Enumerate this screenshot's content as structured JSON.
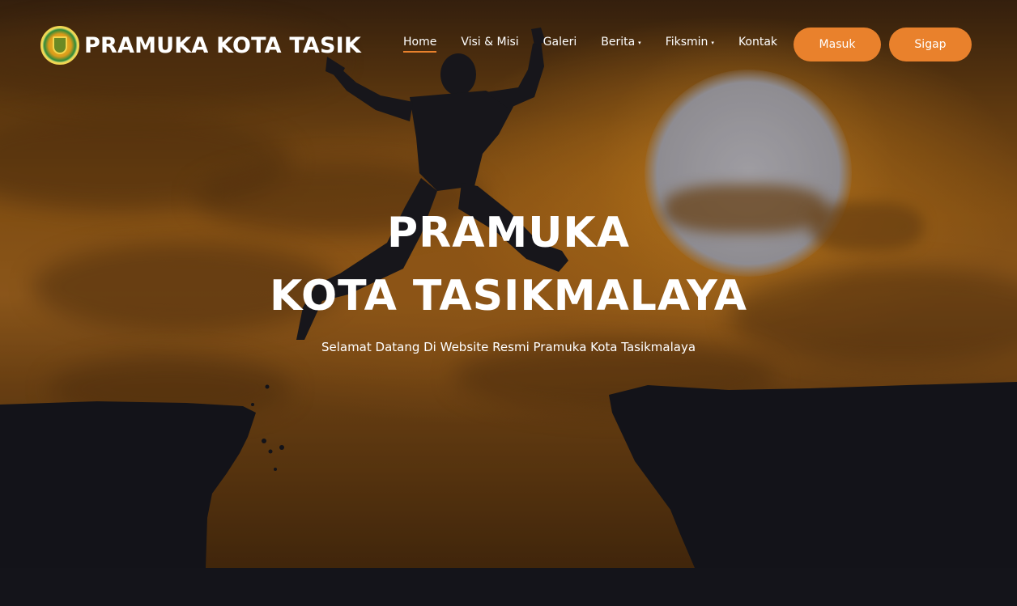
{
  "brand": {
    "name": "PRAMUKA KOTA TASIK"
  },
  "nav": {
    "items": [
      {
        "label": "Home",
        "active": true,
        "dropdown": false
      },
      {
        "label": "Visi & Misi",
        "active": false,
        "dropdown": false
      },
      {
        "label": "Galeri",
        "active": false,
        "dropdown": false
      },
      {
        "label": "Berita",
        "active": false,
        "dropdown": true
      },
      {
        "label": "Fiksmin",
        "active": false,
        "dropdown": true
      },
      {
        "label": "Kontak",
        "active": false,
        "dropdown": false
      }
    ],
    "dropdown_glyph": "▾"
  },
  "buttons": {
    "masuk": "Masuk",
    "sigap": "Sigap"
  },
  "hero": {
    "title_line1": "PRAMUKA",
    "title_line2": "KOTA TASIKMALAYA",
    "subtitle": "Selamat Datang Di Website Resmi Pramuka Kota Tasikmalaya"
  },
  "colors": {
    "accent": "#e9812c",
    "text": "#ffffff",
    "bottom_band": "#14141a"
  },
  "icons": {
    "logo": "pramuka-emblem-icon",
    "dropdown": "caret-down-icon"
  }
}
